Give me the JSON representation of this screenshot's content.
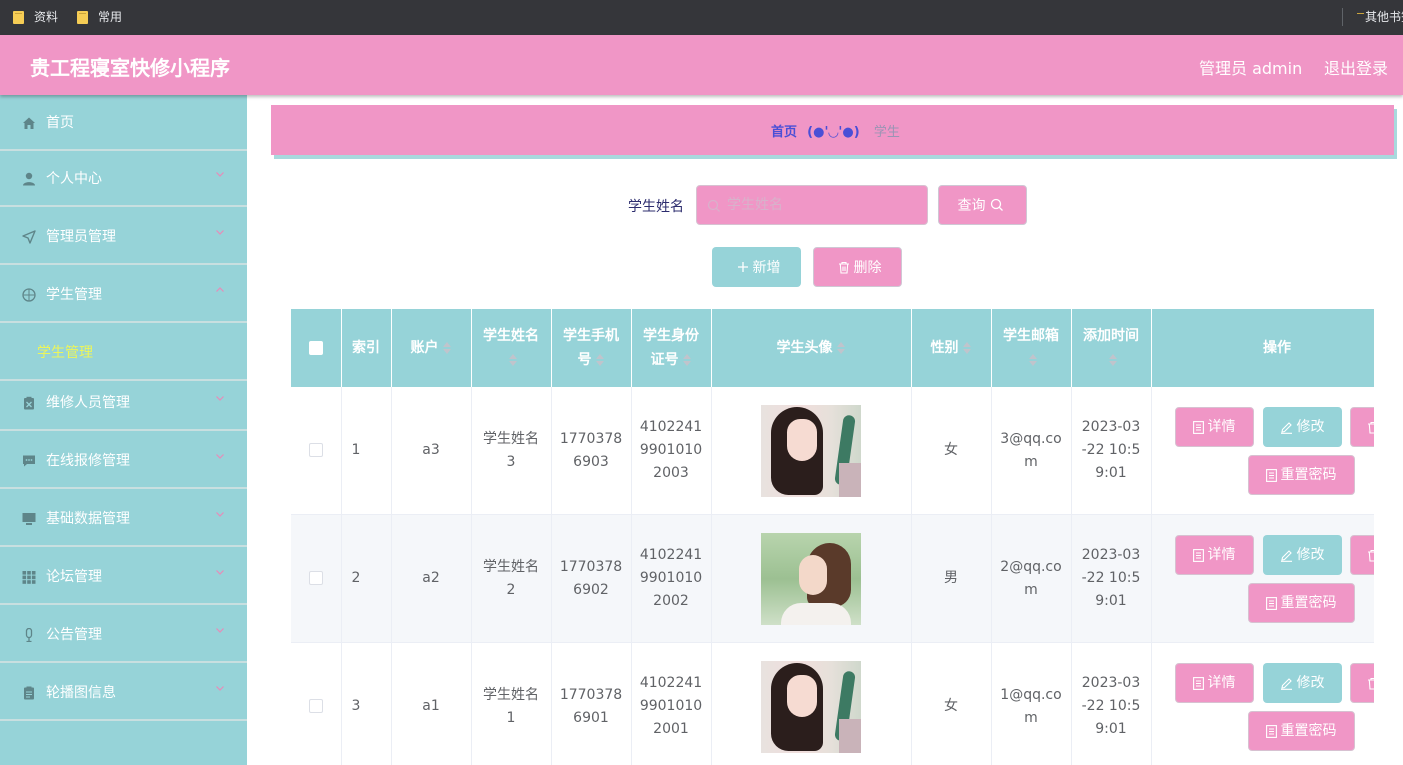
{
  "bookmarks": {
    "items": [
      {
        "label": "资料",
        "icon": "folder-icon"
      },
      {
        "label": "常用",
        "icon": "folder-icon"
      }
    ],
    "other": "其他书签"
  },
  "header": {
    "title": "贵工程寝室快修小程序",
    "admin": "管理员 admin",
    "logout": "退出登录"
  },
  "sidebar": {
    "items": [
      {
        "label": "首页",
        "icon": "home-icon"
      },
      {
        "label": "个人中心",
        "icon": "user-icon"
      },
      {
        "label": "管理员管理",
        "icon": "send-icon"
      },
      {
        "label": "学生管理",
        "icon": "globe-icon",
        "expanded": true
      },
      {
        "label": "维修人员管理",
        "icon": "clipboard-icon"
      },
      {
        "label": "在线报修管理",
        "icon": "chat-icon"
      },
      {
        "label": "基础数据管理",
        "icon": "monitor-icon"
      },
      {
        "label": "论坛管理",
        "icon": "grid-icon"
      },
      {
        "label": "公告管理",
        "icon": "mic-icon"
      },
      {
        "label": "轮播图信息",
        "icon": "list-icon"
      }
    ],
    "sub_active": "学生管理"
  },
  "breadcrumb": {
    "home": "首页",
    "separator": "(●'◡'●)",
    "current": "学生"
  },
  "search": {
    "label": "学生姓名",
    "placeholder": "学生姓名",
    "query_label": "查询",
    "add_label": "新增",
    "delete_label": "删除"
  },
  "table": {
    "headers": {
      "index": "索引",
      "account": "账户",
      "name": "学生姓名",
      "phone": "学生手机号",
      "idcard": "学生身份证号",
      "avatar": "学生头像",
      "gender": "性别",
      "email": "学生邮箱",
      "added": "添加时间",
      "ops": "操作"
    },
    "rows": [
      {
        "index": "1",
        "account": "a3",
        "name": "学生姓名3",
        "phone": "17703786903",
        "idcard": "410224199010102003",
        "gender": "女",
        "email": "3@qq.com",
        "added": "2023-03-22 10:59:01"
      },
      {
        "index": "2",
        "account": "a2",
        "name": "学生姓名2",
        "phone": "17703786902",
        "idcard": "410224199010102002",
        "gender": "男",
        "email": "2@qq.com",
        "added": "2023-03-22 10:59:01"
      },
      {
        "index": "3",
        "account": "a1",
        "name": "学生姓名1",
        "phone": "17703786901",
        "idcard": "410224199010102001",
        "gender": "女",
        "email": "1@qq.com",
        "added": "2023-03-22 10:59:01"
      }
    ],
    "actions": {
      "detail": "详情",
      "edit": "修改",
      "delete": "删除",
      "reset": "重置密码"
    }
  },
  "colors": {
    "pink": "#f096c6",
    "teal": "#96d3d8",
    "active_sub": "#ecf55a"
  }
}
